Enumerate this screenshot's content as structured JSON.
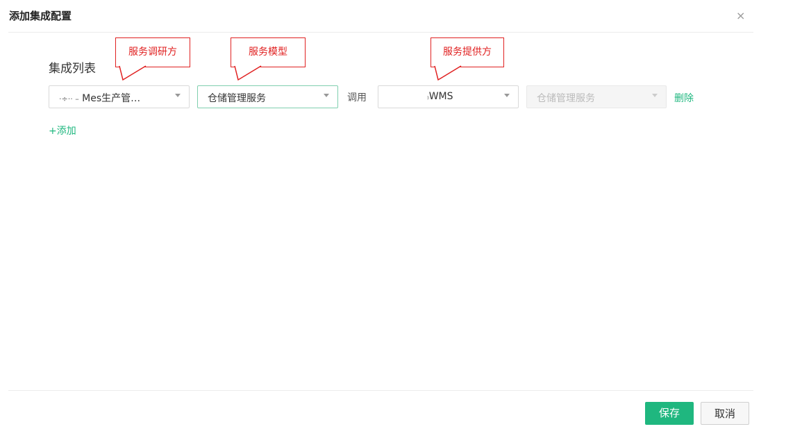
{
  "dialog": {
    "title": "添加集成配置",
    "close_glyph": "×"
  },
  "section": {
    "label": "集成列表"
  },
  "callouts": [
    {
      "text": "服务调研方"
    },
    {
      "text": "服务模型"
    },
    {
      "text": "服务提供方"
    }
  ],
  "row": {
    "caller_value": "Mes生产管…",
    "caller_prefix": "·÷·· –",
    "model_value": "仓储管理服务",
    "invoke_label": "调用",
    "provider_value": "WMS",
    "provider_prefix": "₎",
    "provider_model_value": "仓储管理服务",
    "delete_label": "删除"
  },
  "add_label": "+添加",
  "footer": {
    "save_label": "保存",
    "cancel_label": "取消"
  },
  "colors": {
    "accent": "#1fb77f",
    "callout": "#e02020",
    "focus_border": "#7fcfae"
  }
}
